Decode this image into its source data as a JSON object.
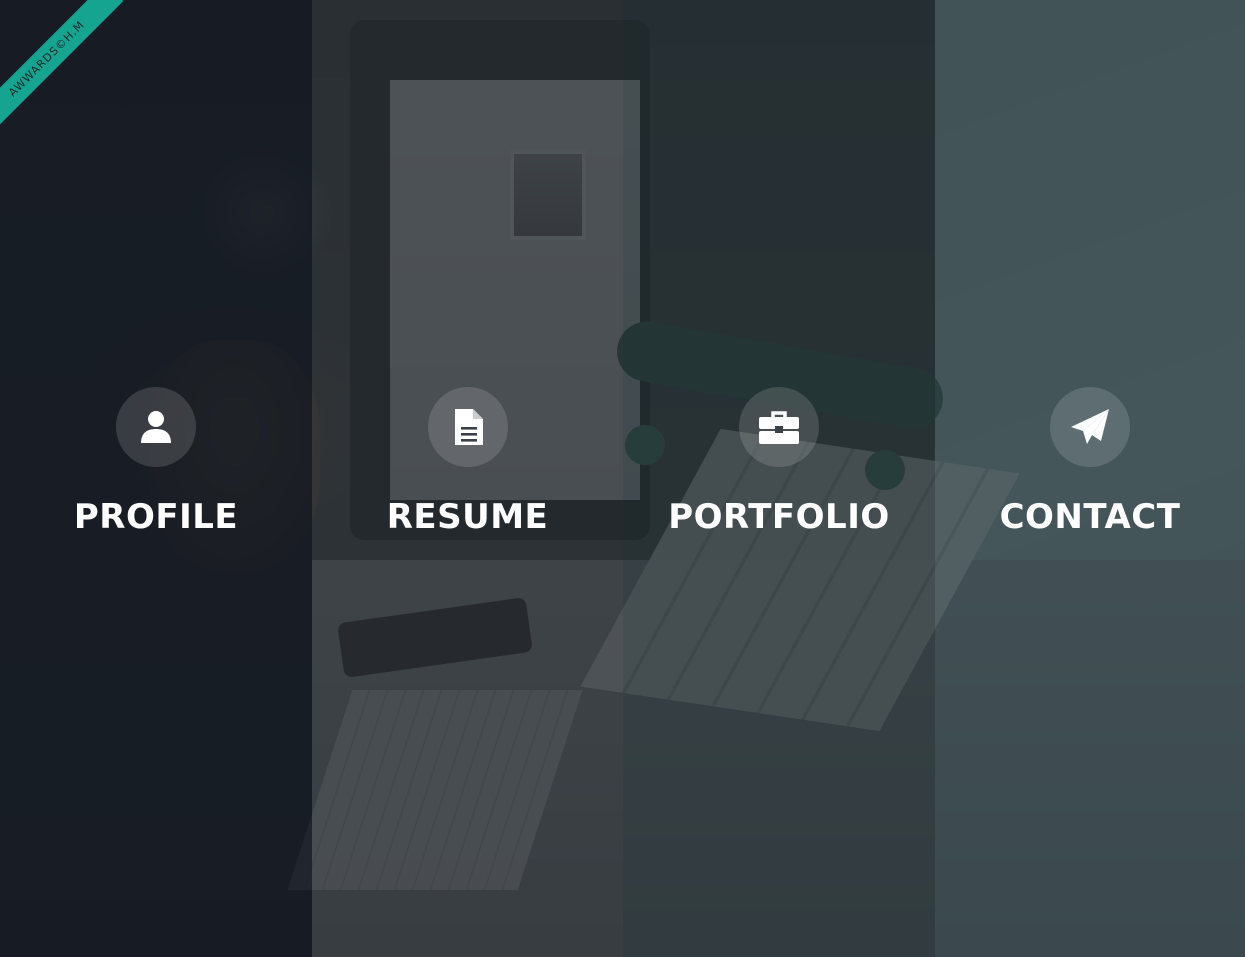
{
  "ribbon": {
    "text": "AWWARDS©H.M",
    "color": "#14a48f"
  },
  "nav": {
    "items": [
      {
        "label": "PROFILE",
        "icon": "user-icon"
      },
      {
        "label": "RESUME",
        "icon": "document-icon"
      },
      {
        "label": "PORTFOLIO",
        "icon": "briefcase-icon"
      },
      {
        "label": "CONTACT",
        "icon": "paper-plane-icon"
      }
    ]
  }
}
